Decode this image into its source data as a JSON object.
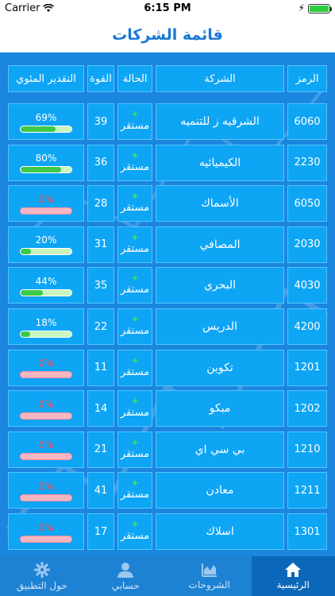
{
  "status_bar": {
    "carrier": "Carrier",
    "time": "6:15 PM"
  },
  "nav": {
    "title": "قائمة الشركات"
  },
  "table": {
    "headers": {
      "code": "الرمز",
      "company": "الشركة",
      "status": "الحالة",
      "power": "القوة",
      "rating": "التقدير المئوي"
    },
    "rows": [
      {
        "code": "6060",
        "company": "الشرقيه ز للتنميه",
        "status": "مستقر",
        "status_icon": "star-icon",
        "power": "39",
        "rating": "69%",
        "rating_value": 69
      },
      {
        "code": "2230",
        "company": "الكيميائيه",
        "status": "مستقر",
        "status_icon": "star-icon",
        "power": "36",
        "rating": "80%",
        "rating_value": 80
      },
      {
        "code": "6050",
        "company": "الأسماك",
        "status": "مستقر",
        "status_icon": "star-icon",
        "power": "28",
        "rating": "0%",
        "rating_value": 0
      },
      {
        "code": "2030",
        "company": "المصافي",
        "status": "مستقر",
        "status_icon": "star-icon",
        "power": "31",
        "rating": "20%",
        "rating_value": 20
      },
      {
        "code": "4030",
        "company": "البحري",
        "status": "مستقر",
        "status_icon": "star-icon",
        "power": "35",
        "rating": "44%",
        "rating_value": 44
      },
      {
        "code": "4200",
        "company": "الدريس",
        "status": "مستقر",
        "status_icon": "star-icon",
        "power": "22",
        "rating": "18%",
        "rating_value": 18
      },
      {
        "code": "1201",
        "company": "تكوين",
        "status": "مستقر",
        "status_icon": "star-icon",
        "power": "11",
        "rating": "0%",
        "rating_value": 0
      },
      {
        "code": "1202",
        "company": "مبكو",
        "status": "مستقر",
        "status_icon": "star-icon",
        "power": "14",
        "rating": "0%",
        "rating_value": 0
      },
      {
        "code": "1210",
        "company": "بي سي اي",
        "status": "مستقر",
        "status_icon": "star-icon",
        "power": "21",
        "rating": "0%",
        "rating_value": 0
      },
      {
        "code": "1211",
        "company": "معادن",
        "status": "مستقر",
        "status_icon": "star-icon",
        "power": "41",
        "rating": "0%",
        "rating_value": 0
      },
      {
        "code": "1301",
        "company": "اسلاك",
        "status": "مستقر",
        "status_icon": "star-icon",
        "power": "17",
        "rating": "0%",
        "rating_value": 0
      }
    ]
  },
  "tabs": [
    {
      "label": "الرئيسية",
      "icon": "home-icon",
      "active": true
    },
    {
      "label": "الشروحات",
      "icon": "chart-icon",
      "active": false
    },
    {
      "label": "حسابي",
      "icon": "user-icon",
      "active": false
    },
    {
      "label": "حول التطبيق",
      "icon": "gear-icon",
      "active": false
    }
  ],
  "colors": {
    "accent": "#1879d6",
    "content_bg": "#1a86de",
    "cell_bg": "#0ea5f5",
    "progress_green": "#3ec94a",
    "progress_zero": "#f4b6c2",
    "status_star": "#35e06b"
  }
}
